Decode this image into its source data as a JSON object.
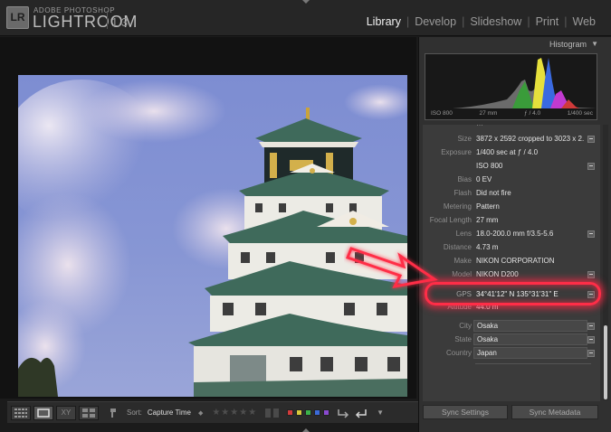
{
  "app": {
    "logo_text": "LR",
    "brand_small": "ADOBE PHOTOSHOP",
    "brand_big": "LIGHTROOM",
    "version": "1.3"
  },
  "modules": [
    {
      "label": "Library",
      "active": true
    },
    {
      "label": "Develop",
      "active": false
    },
    {
      "label": "Slideshow",
      "active": false
    },
    {
      "label": "Print",
      "active": false
    },
    {
      "label": "Web",
      "active": false
    }
  ],
  "histogram": {
    "title": "Histogram",
    "iso": "ISO 800",
    "focal": "27 mm",
    "aperture": "ƒ / 4.0",
    "shutter": "1/400 sec"
  },
  "metadata": {
    "rows": [
      {
        "label": "Size",
        "value": "3872 x 2592 cropped to 3023 x 2...",
        "button": true
      },
      {
        "label": "Exposure",
        "value": "1/400 sec at ƒ / 4.0",
        "button": false
      },
      {
        "label": "",
        "value": "ISO 800",
        "button": true
      },
      {
        "label": "Bias",
        "value": "0 EV",
        "button": false
      },
      {
        "label": "Flash",
        "value": "Did not fire",
        "button": false
      },
      {
        "label": "Metering",
        "value": "Pattern",
        "button": false
      },
      {
        "label": "Focal Length",
        "value": "27 mm",
        "button": false
      },
      {
        "label": "Lens",
        "value": "18.0-200.0 mm f/3.5-5.6",
        "button": true
      },
      {
        "label": "Distance",
        "value": "4.73 m",
        "button": false
      },
      {
        "label": "Make",
        "value": "NIKON CORPORATION",
        "button": false
      },
      {
        "label": "Model",
        "value": "NIKON D200",
        "button": true
      }
    ],
    "gps": {
      "label": "GPS",
      "value": "34°41'12\" N 135°31'31\" E"
    },
    "altitude": {
      "label": "Altitude",
      "value": "44.0 m"
    },
    "location": [
      {
        "label": "City",
        "value": "Osaka"
      },
      {
        "label": "State",
        "value": "Osaka"
      },
      {
        "label": "Country",
        "value": "Japan"
      }
    ]
  },
  "toolbar": {
    "xy_label": "XY",
    "sort_label": "Sort:",
    "sort_value": "Capture Time",
    "stars": "★★★★★",
    "color_labels": [
      "#d23b3b",
      "#d8c93b",
      "#3bb24a",
      "#3b6ad8",
      "#8a4ad0"
    ]
  },
  "sync": {
    "settings_label": "Sync Settings",
    "metadata_label": "Sync Metadata"
  },
  "annotation": {
    "color": "#ff2d47"
  }
}
